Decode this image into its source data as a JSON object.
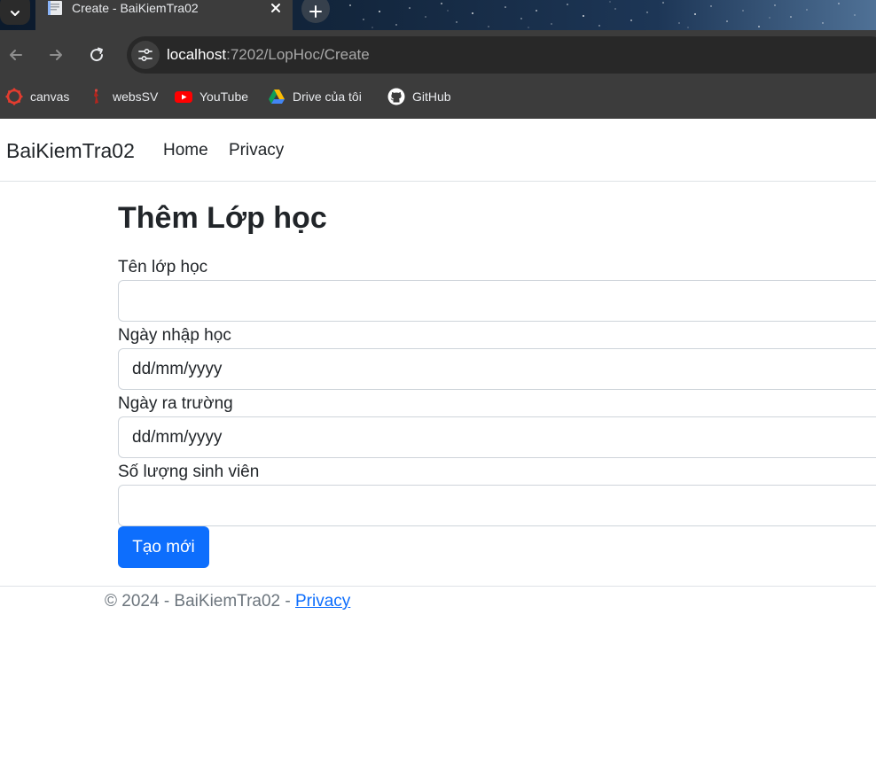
{
  "browser": {
    "tab_title": "Create - BaiKiemTra02",
    "url_host": "localhost",
    "url_rest": ":7202/LopHoc/Create",
    "bookmarks": [
      {
        "label": "canvas",
        "icon": "canvas-icon"
      },
      {
        "label": "websSV",
        "icon": "webssv-icon"
      },
      {
        "label": "YouTube",
        "icon": "youtube-icon"
      },
      {
        "label": "Drive của tôi",
        "icon": "google-drive-icon"
      },
      {
        "label": "GitHub",
        "icon": "github-icon"
      }
    ]
  },
  "navbar": {
    "brand": "BaiKiemTra02",
    "links": [
      "Home",
      "Privacy"
    ]
  },
  "form": {
    "title": "Thêm Lớp học",
    "fields": [
      {
        "label": "Tên lớp học",
        "value": ""
      },
      {
        "label": "Ngày nhập học",
        "value": "dd/mm/yyyy"
      },
      {
        "label": "Ngày ra trường",
        "value": "dd/mm/yyyy"
      },
      {
        "label": "Số lượng sinh viên",
        "value": ""
      }
    ],
    "submit_label": "Tạo mới"
  },
  "footer": {
    "text": "© 2024 - BaiKiemTra02 - ",
    "link_label": "Privacy"
  },
  "colors": {
    "primary": "#0d6efd",
    "chrome_toolbar": "#3c3c3c",
    "omnibox": "#282828",
    "text": "#212529",
    "muted": "#6c757d"
  }
}
